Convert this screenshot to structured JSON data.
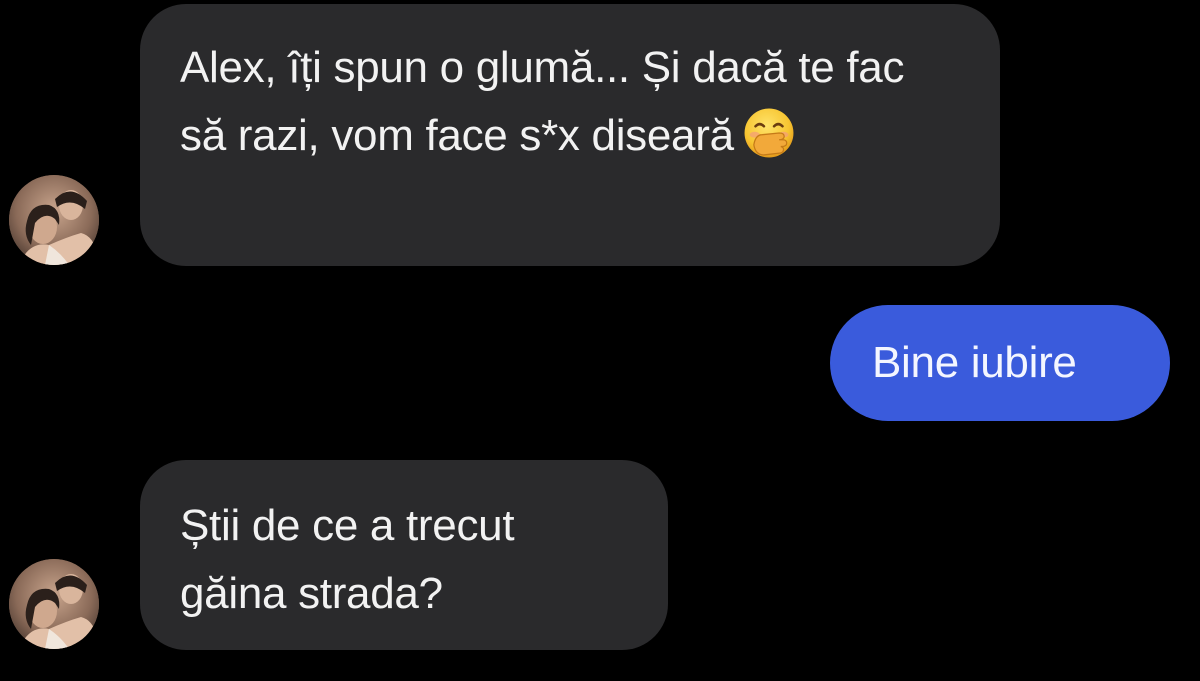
{
  "conversation": {
    "messages": [
      {
        "direction": "incoming",
        "text": "Alex, îți spun o glumă... Și dacă te fac să razi, vom face s*x diseară",
        "emoji": "face-with-hand-over-mouth"
      },
      {
        "direction": "outgoing",
        "text": "Bine iubire"
      },
      {
        "direction": "incoming",
        "text": "Știi de ce a trecut găina strada?"
      }
    ]
  },
  "colors": {
    "background": "#000000",
    "incoming_bubble": "#2a2a2c",
    "outgoing_bubble": "#3a5bdc",
    "text": "#ffffff"
  }
}
